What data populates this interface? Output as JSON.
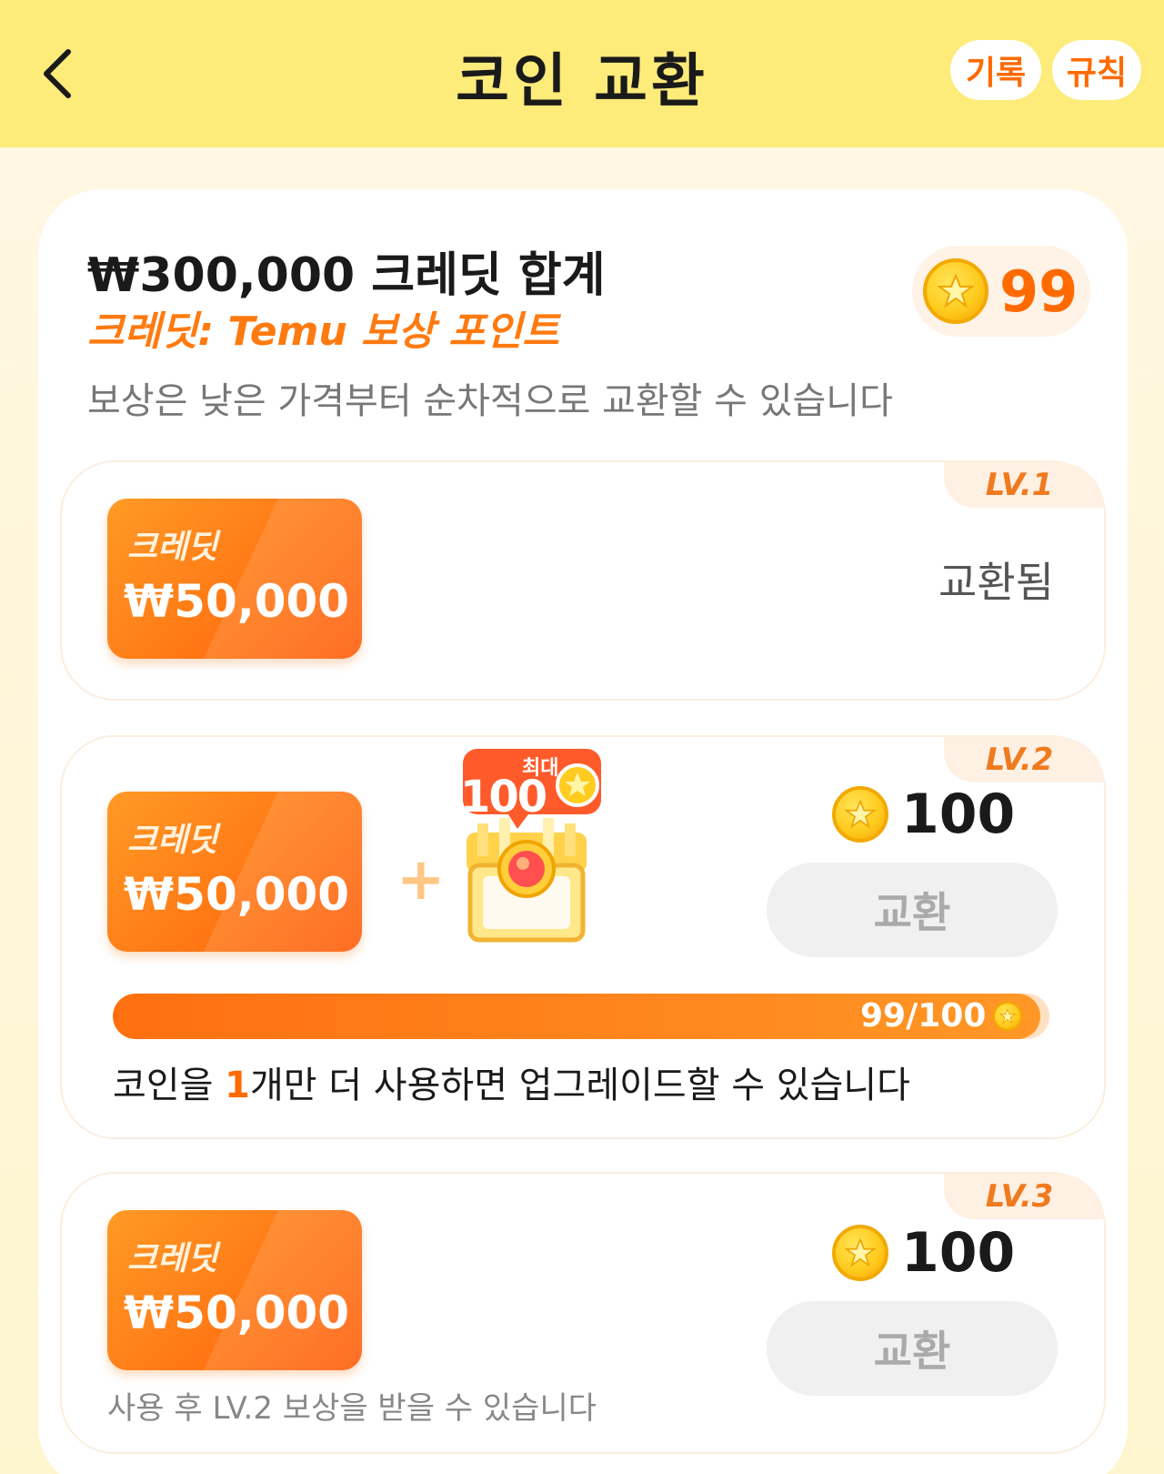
{
  "header": {
    "title": "코인 교환",
    "record_label": "기록",
    "rules_label": "규칙"
  },
  "summary": {
    "total_title": "₩300,000 크레딧 합계",
    "credit_subtitle": "크레딧: Temu 보상 포인트",
    "notice": "보상은 낮은 가격부터 순차적으로 교환할 수 있습니다",
    "coin_balance": "99"
  },
  "tiers": [
    {
      "level": "LV.1",
      "ticket_label": "크레딧",
      "ticket_amount": "₩50,000",
      "status": "교환됨"
    },
    {
      "level": "LV.2",
      "ticket_label": "크레딧",
      "ticket_amount": "₩50,000",
      "bonus_max_label": "최대",
      "bonus_amount": "100",
      "price": "100",
      "button_label": "교환",
      "progress_text": "99/100",
      "progress_fraction": 0.99,
      "upgrade_prefix": "코인을 ",
      "upgrade_count": "1",
      "upgrade_suffix": "개만 더 사용하면 업그레이드할 수 있습니다"
    },
    {
      "level": "LV.3",
      "ticket_label": "크레딧",
      "ticket_amount": "₩50,000",
      "price": "100",
      "button_label": "교환",
      "note": "사용 후 LV.2 보상을 받을 수 있습니다"
    }
  ],
  "colors": {
    "header_bg": "#fdeb7a",
    "accent": "#ff6a00",
    "coin": "#ffcc1f"
  },
  "icons": [
    "back-arrow-icon",
    "coin-icon",
    "treasure-chest-icon",
    "plus-icon"
  ]
}
